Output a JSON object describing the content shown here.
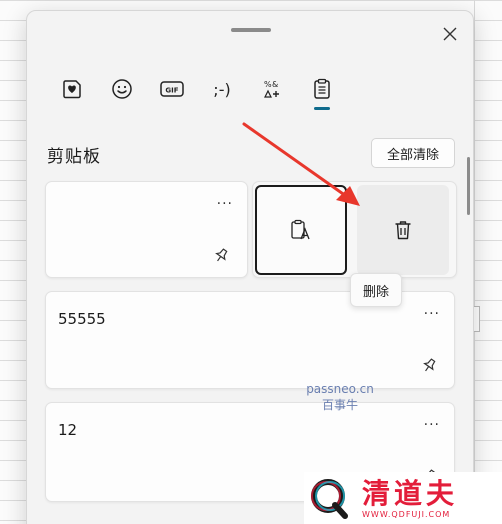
{
  "tabs": [
    {
      "name": "heart-sticker-icon"
    },
    {
      "name": "emoji-icon"
    },
    {
      "name": "gif-icon",
      "label": "GIF"
    },
    {
      "name": "kaomoji-icon",
      "label": ";-)"
    },
    {
      "name": "symbols-icon"
    },
    {
      "name": "clipboard-icon"
    }
  ],
  "active_tab": "clipboard",
  "clipboard": {
    "title": "剪贴板",
    "clear_all_label": "全部清除",
    "more_label": "···",
    "delete_tooltip": "删除",
    "items": [
      {
        "text": ""
      },
      {
        "text": "55555"
      },
      {
        "text": "12"
      }
    ]
  },
  "watermark": {
    "line1": "passneo.cn",
    "line2": "百事牛"
  },
  "brand": {
    "name": "清道夫",
    "url": "WWW.QDFUJI.COM"
  },
  "colors": {
    "accent": "#0f6b8c",
    "annotation_arrow": "#e8372c",
    "brand": "#e31d3a"
  }
}
